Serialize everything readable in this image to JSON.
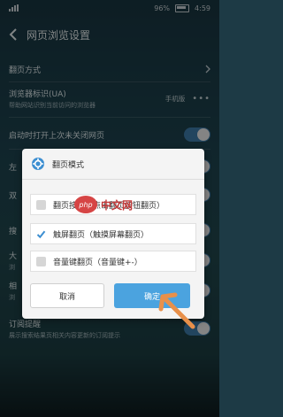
{
  "status_bar": {
    "battery_percent": "96%",
    "time": "4:59"
  },
  "header": {
    "title": "网页浏览设置"
  },
  "settings": [
    {
      "label": "翻页方式",
      "sub": "",
      "value": ""
    },
    {
      "label": "浏览器标识(UA)",
      "sub": "帮助网站识别当前访问的浏览器",
      "value": "手机版"
    },
    {
      "label": "启动时打开上次未关闭网页",
      "sub": "",
      "value": ""
    },
    {
      "label": "左",
      "sub": "",
      "value": ""
    },
    {
      "label": "双",
      "sub": "",
      "value": ""
    },
    {
      "label": "搜",
      "sub": "",
      "value": ""
    },
    {
      "label": "大",
      "sub": "浏",
      "value": ""
    },
    {
      "label": "相",
      "sub": "浏",
      "value": ""
    },
    {
      "label": "订阅提醒",
      "sub": "展示搜索结果页相关内容更新的订阅提示",
      "value": ""
    }
  ],
  "dialog": {
    "title": "翻页模式",
    "options": [
      {
        "label": "翻页按钮（点击翻页按钮翻页）",
        "checked": false
      },
      {
        "label": "触屏翻页（触摸屏幕翻页）",
        "checked": true
      },
      {
        "label": "音量键翻页（音量键+-）",
        "checked": false
      }
    ],
    "cancel_label": "取消",
    "ok_label": "确定"
  },
  "watermark": {
    "logo": "php",
    "text": "中文网"
  },
  "colors": {
    "accent": "#4ba3df",
    "toggle_on": "#3f7fae",
    "arrow": "#e8904a"
  }
}
